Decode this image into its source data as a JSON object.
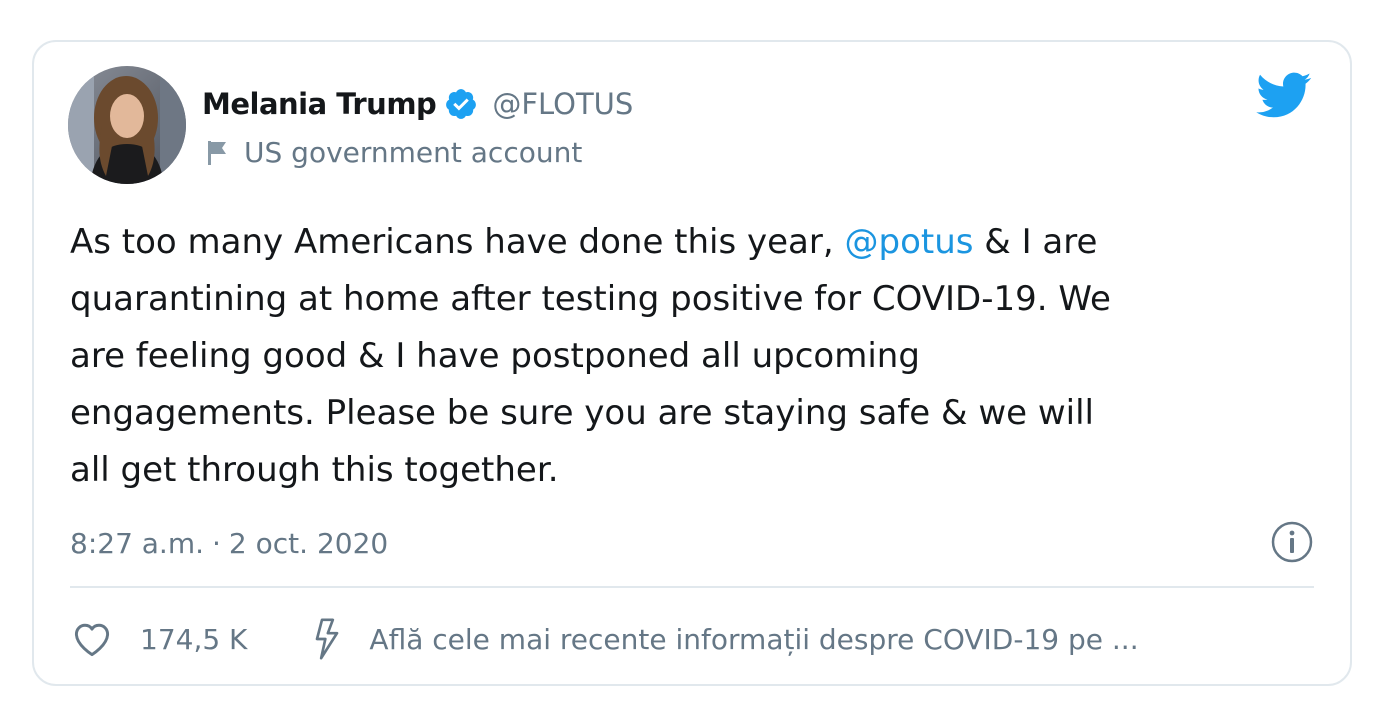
{
  "author": {
    "display_name": "Melania Trump",
    "handle": "@FLOTUS",
    "label": "US government account",
    "verified": true
  },
  "tweet": {
    "text_before_mention": "As too many Americans have done this year, ",
    "mention": "@potus",
    "text_after_mention": " & I are\nquarantining at home after testing positive for COVID-19. We\nare feeling good & I have postponed all upcoming\nengagements. Please be sure you are staying safe & we will\nall get through this together."
  },
  "meta": {
    "time": "8:27 a.m.",
    "separator": "·",
    "date": "2 oct. 2020"
  },
  "actions": {
    "like_count": "174,5 K",
    "covid_info_link": "Află cele mai recente informații despre COVID-19 pe ..."
  },
  "icons": {
    "verified": "verified-badge-icon",
    "flag": "flag-icon",
    "logo": "twitter-bird-icon",
    "info": "info-icon",
    "like": "heart-icon",
    "covid": "lightning-bolt-icon"
  },
  "colors": {
    "brand_blue": "#1da1f2",
    "mention": "#1b95e0",
    "secondary_text": "#657786",
    "primary_text": "#14171a",
    "border": "#e1e8ed"
  }
}
